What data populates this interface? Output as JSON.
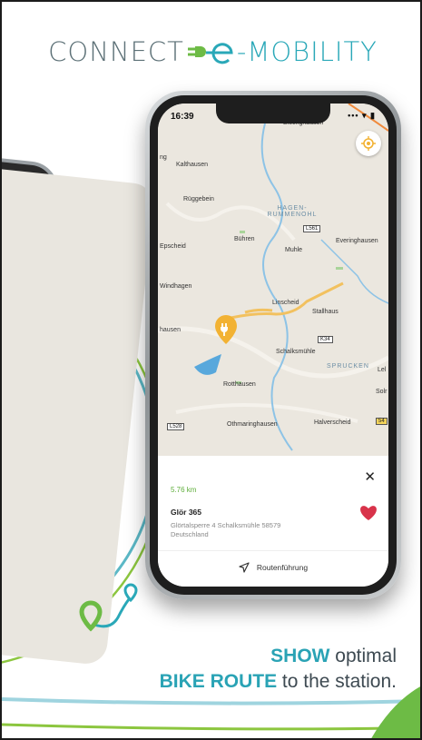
{
  "brand": {
    "prefix": "CONNECT",
    "suffix": "-MOBILITY",
    "colors": {
      "gray": "#5d7177",
      "teal": "#2aa8b8",
      "green": "#6dbb45"
    }
  },
  "phone": {
    "status": {
      "time": "16:39",
      "signal": "••• ▾ ▮"
    },
    "map_labels": [
      {
        "text": "Bietinghausen"
      },
      {
        "text": "Kalthausen"
      },
      {
        "text": "Rüggebein"
      },
      {
        "text": "HAGEN-RUMMENOHL"
      },
      {
        "text": "L561"
      },
      {
        "text": "Epscheid"
      },
      {
        "text": "Bühren"
      },
      {
        "text": "Muhle"
      },
      {
        "text": "Everinghausen"
      },
      {
        "text": "Windhagen"
      },
      {
        "text": "Linscheid"
      },
      {
        "text": "Stallhaus"
      },
      {
        "text": "hausen"
      },
      {
        "text": "K34"
      },
      {
        "text": "Schalksmühle"
      },
      {
        "text": "SPRUCKEN"
      },
      {
        "text": "Lel"
      },
      {
        "text": "Rotthausen"
      },
      {
        "text": "Solr"
      },
      {
        "text": "L528"
      },
      {
        "text": "Othmaringhausen"
      },
      {
        "text": "Halverscheid"
      },
      {
        "text": "54"
      },
      {
        "text": "ng"
      }
    ],
    "card": {
      "distance": "5.76 km",
      "station_name": "Glör 365",
      "address_line1": "Glörtalsperre 4 Schalksmühle 58579",
      "address_line2": "Deutschland",
      "close_label": "✕",
      "route_label": "Routenführung",
      "heart_color": "#d8334a"
    },
    "icons": [
      "locate-icon",
      "charging-pin-icon",
      "close-icon",
      "heart-icon",
      "navigation-arrow-icon"
    ]
  },
  "tagline": {
    "line1_bold": "SHOW",
    "line1_rest": " optimal",
    "line2_bold": "BIKE ROUTE",
    "line2_rest": " to the station."
  }
}
